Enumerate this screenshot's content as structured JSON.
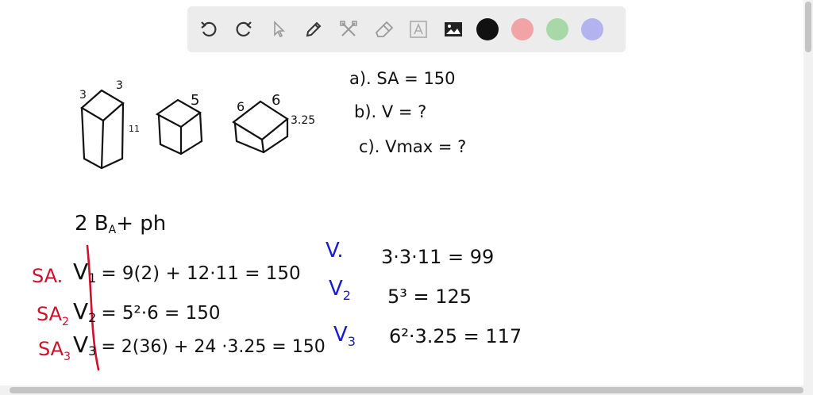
{
  "toolbar": {
    "tools": [
      "undo-icon",
      "redo-icon",
      "pointer-icon",
      "pen-icon",
      "tools-icon",
      "eraser-icon",
      "text-icon",
      "image-icon"
    ],
    "colors": [
      "#111111",
      "#f2a3a6",
      "#a8d8a8",
      "#b3b3f0"
    ]
  },
  "notes": {
    "box1_top": "3",
    "box1_side": "3",
    "box1_height": "11",
    "box2_label": "5",
    "box3_left": "6",
    "box3_right": "6",
    "box3_height": "3.25",
    "q_a": "a). SA = 150",
    "q_b": "b). V = ?",
    "q_c": "c). Vmax = ?",
    "formula": "2 B",
    "formula_sub": "A",
    "formula_rest": "+ ph",
    "sa1_label": "SA.",
    "sa2_label": "SA",
    "sa2_sub": "2",
    "sa3_label": "SA",
    "sa3_sub": "3",
    "v1_left": "V",
    "v1_sub": "1",
    "v1_rest": "= 9(2) + 12·11 = 150",
    "v2_left": "V",
    "v2_sub": "2",
    "v2_rest": "= 5²·6 = 150",
    "v3_left": "V",
    "v3_sub": "3",
    "v3_rest": "= 2(36) + 24 ·3.25 = 150",
    "vol1_label": "V.",
    "vol1_rest": "3·3·11 = 99",
    "vol2_label": "V",
    "vol2_sub": "2",
    "vol2_rest": "5³ = 125",
    "vol3_label": "V",
    "vol3_sub": "3",
    "vol3_rest": "6²·3.25 = 117",
    "colors": {
      "ink": "#111111",
      "red": "#d0102a",
      "blue": "#1a1ad0"
    }
  }
}
